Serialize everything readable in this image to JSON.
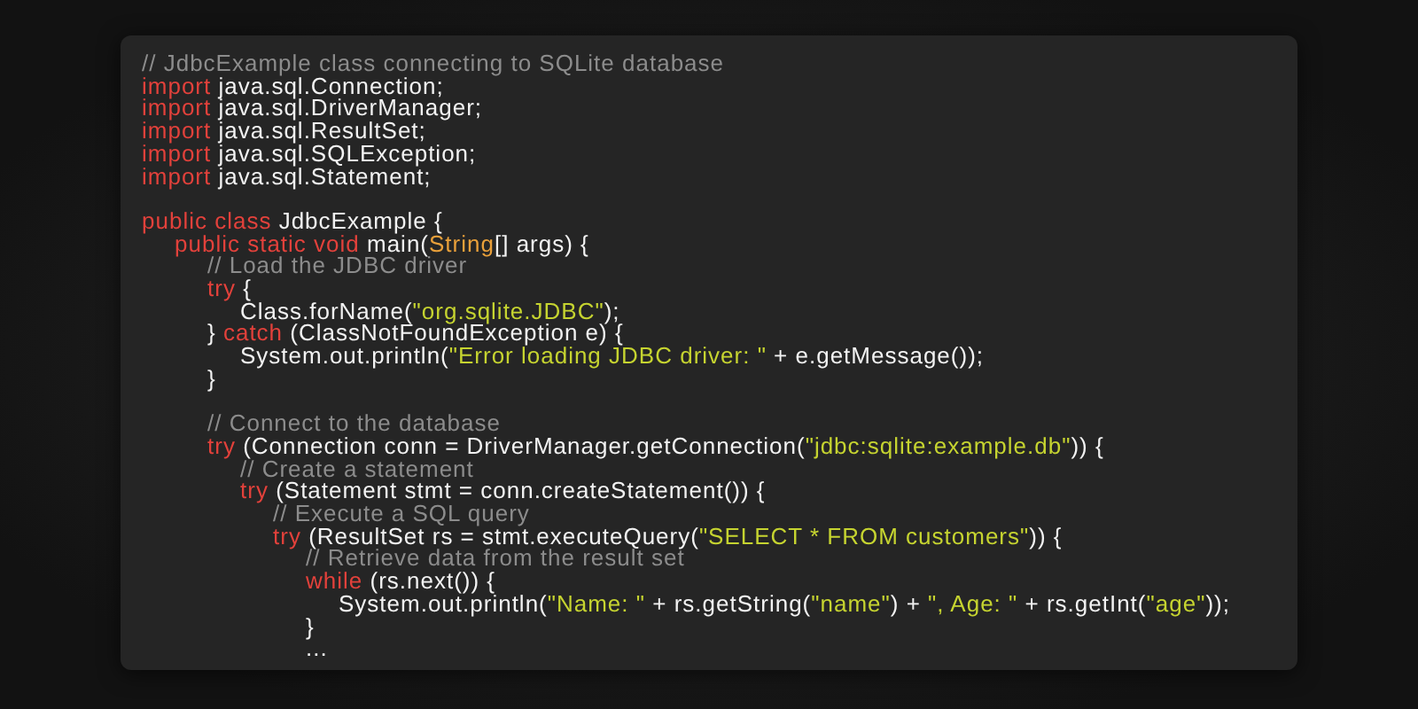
{
  "code_lines": [
    {
      "tokens": [
        {
          "kind": "comment",
          "text": "// JdbcExample class connecting to SQLite database"
        }
      ]
    },
    {
      "tokens": [
        {
          "kind": "keyword",
          "text": "import"
        },
        {
          "kind": "plain",
          "text": " java.sql.Connection;"
        }
      ]
    },
    {
      "tokens": [
        {
          "kind": "keyword",
          "text": "import"
        },
        {
          "kind": "plain",
          "text": " java.sql.DriverManager;"
        }
      ]
    },
    {
      "tokens": [
        {
          "kind": "keyword",
          "text": "import"
        },
        {
          "kind": "plain",
          "text": " java.sql.ResultSet;"
        }
      ]
    },
    {
      "tokens": [
        {
          "kind": "keyword",
          "text": "import"
        },
        {
          "kind": "plain",
          "text": " java.sql.SQLException;"
        }
      ]
    },
    {
      "tokens": [
        {
          "kind": "keyword",
          "text": "import"
        },
        {
          "kind": "plain",
          "text": " java.sql.Statement;"
        }
      ]
    },
    {
      "kind": "blank"
    },
    {
      "tokens": [
        {
          "kind": "keyword",
          "text": "public class"
        },
        {
          "kind": "plain",
          "text": " JdbcExample {"
        }
      ]
    },
    {
      "tokens": [
        {
          "kind": "keyword",
          "text": "\tpublic static void"
        },
        {
          "kind": "plain",
          "text": " main("
        },
        {
          "kind": "type",
          "text": "String"
        },
        {
          "kind": "plain",
          "text": "[] args) {"
        }
      ]
    },
    {
      "tokens": [
        {
          "kind": "comment",
          "text": "\t\t// Load the JDBC driver"
        }
      ]
    },
    {
      "tokens": [
        {
          "kind": "keyword",
          "text": "\t\ttry"
        },
        {
          "kind": "plain",
          "text": " {"
        }
      ]
    },
    {
      "tokens": [
        {
          "kind": "plain",
          "text": "\t\t\tClass.forName("
        },
        {
          "kind": "string",
          "text": "\"org.sqlite.JDBC\""
        },
        {
          "kind": "plain",
          "text": ");"
        }
      ]
    },
    {
      "tokens": [
        {
          "kind": "plain",
          "text": "\t\t} "
        },
        {
          "kind": "keyword",
          "text": "catch"
        },
        {
          "kind": "plain",
          "text": " (ClassNotFoundException e) {"
        }
      ]
    },
    {
      "tokens": [
        {
          "kind": "plain",
          "text": "\t\t\tSystem.out.println("
        },
        {
          "kind": "string",
          "text": "\"Error loading JDBC driver: \""
        },
        {
          "kind": "plain",
          "text": " + e.getMessage());"
        }
      ]
    },
    {
      "tokens": [
        {
          "kind": "plain",
          "text": "\t\t}"
        }
      ]
    },
    {
      "kind": "blank"
    },
    {
      "tokens": [
        {
          "kind": "comment",
          "text": "\t\t// Connect to the database"
        }
      ]
    },
    {
      "tokens": [
        {
          "kind": "keyword",
          "text": "\t\ttry"
        },
        {
          "kind": "plain",
          "text": " (Connection conn = DriverManager.getConnection("
        },
        {
          "kind": "string",
          "text": "\"jdbc:sqlite:example.db\""
        },
        {
          "kind": "plain",
          "text": ")) {"
        }
      ]
    },
    {
      "tokens": [
        {
          "kind": "comment",
          "text": "\t\t\t// Create a statement"
        }
      ]
    },
    {
      "tokens": [
        {
          "kind": "keyword",
          "text": "\t\t\ttry"
        },
        {
          "kind": "plain",
          "text": " (Statement stmt = conn.createStatement()) {"
        }
      ]
    },
    {
      "tokens": [
        {
          "kind": "comment",
          "text": "\t\t\t\t// Execute a SQL query"
        }
      ]
    },
    {
      "tokens": [
        {
          "kind": "keyword",
          "text": "\t\t\t\ttry"
        },
        {
          "kind": "plain",
          "text": " (ResultSet rs = stmt.executeQuery("
        },
        {
          "kind": "string",
          "text": "\"SELECT * FROM customers\""
        },
        {
          "kind": "plain",
          "text": ")) {"
        }
      ]
    },
    {
      "tokens": [
        {
          "kind": "comment",
          "text": "\t\t\t\t\t// Retrieve data from the result set"
        }
      ]
    },
    {
      "tokens": [
        {
          "kind": "keyword",
          "text": "\t\t\t\t\twhile"
        },
        {
          "kind": "plain",
          "text": " (rs.next()) {"
        }
      ]
    },
    {
      "tokens": [
        {
          "kind": "plain",
          "text": "\t\t\t\t\t\tSystem.out.println("
        },
        {
          "kind": "string",
          "text": "\"Name: \""
        },
        {
          "kind": "plain",
          "text": " + rs.getString("
        },
        {
          "kind": "string",
          "text": "\"name\""
        },
        {
          "kind": "plain",
          "text": ") + "
        },
        {
          "kind": "string",
          "text": "\", Age: \""
        },
        {
          "kind": "plain",
          "text": " + rs.getInt("
        },
        {
          "kind": "string",
          "text": "\"age\""
        },
        {
          "kind": "plain",
          "text": "));"
        }
      ]
    },
    {
      "tokens": [
        {
          "kind": "plain",
          "text": "\t\t\t\t\t}"
        }
      ]
    },
    {
      "tokens": [
        {
          "kind": "plain",
          "text": "\t\t\t\t\t..."
        }
      ]
    }
  ]
}
